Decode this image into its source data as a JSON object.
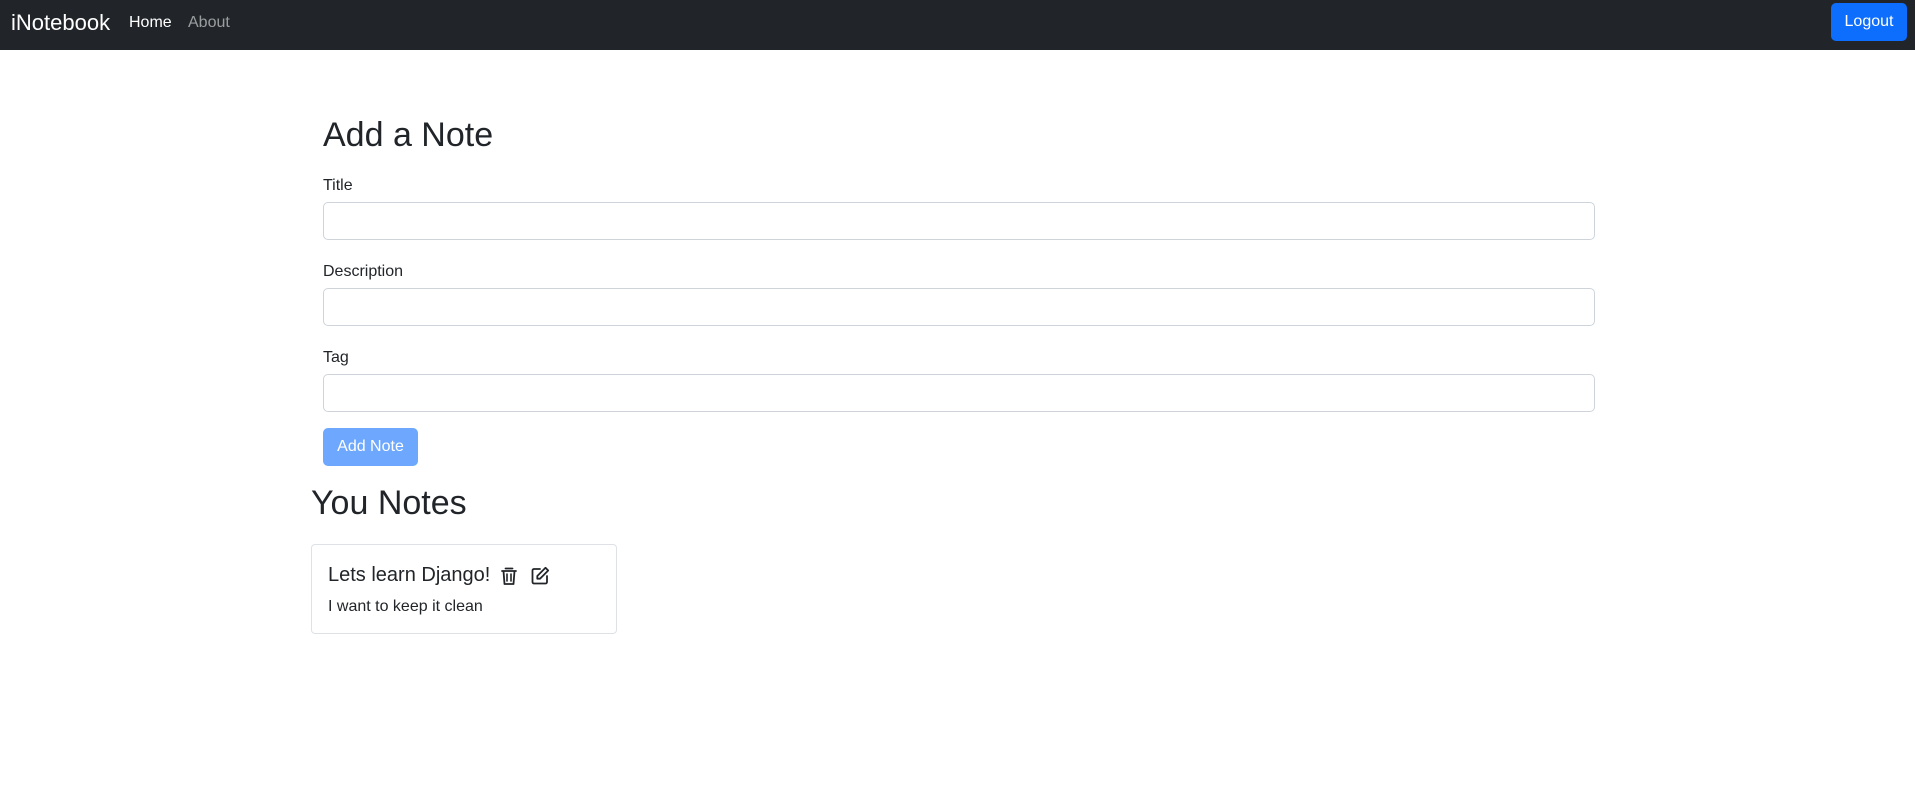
{
  "navbar": {
    "brand": "iNotebook",
    "links": [
      {
        "label": "Home",
        "active": true
      },
      {
        "label": "About",
        "active": false
      }
    ],
    "logout_label": "Logout"
  },
  "add_note": {
    "heading": "Add a Note",
    "fields": [
      {
        "label": "Title",
        "value": ""
      },
      {
        "label": "Description",
        "value": ""
      },
      {
        "label": "Tag",
        "value": ""
      }
    ],
    "submit_label": "Add Note"
  },
  "notes_section": {
    "heading": "You Notes",
    "notes": [
      {
        "title": "Lets learn Django!",
        "description": "I want to keep it clean",
        "icons": [
          "trash-icon",
          "edit-icon"
        ]
      }
    ]
  },
  "colors": {
    "navbar_bg": "#212529",
    "primary": "#0d6efd",
    "primary_disabled": "#6ea8fe"
  }
}
